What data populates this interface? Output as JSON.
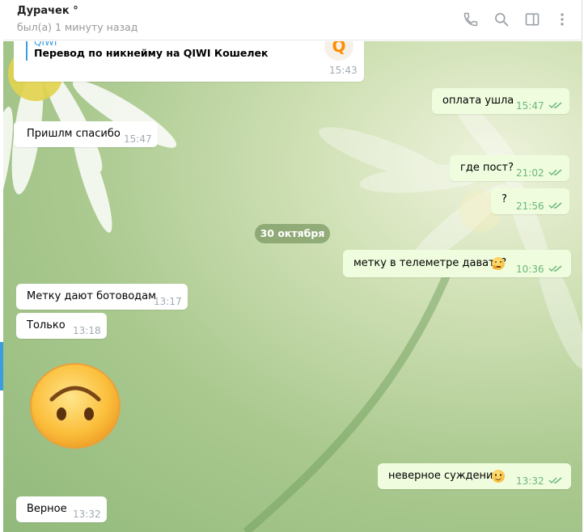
{
  "header": {
    "peer_name": "Дурачек °",
    "peer_status": "был(а) 1 минуту назад",
    "icons": [
      "phone-icon",
      "search-icon",
      "sidebar-toggle-icon",
      "more-vertical-icon"
    ]
  },
  "chat": {
    "qiwi_message": {
      "title_partial": "QIWI",
      "description": "Перевод по никнейму на QIWI Кошелек",
      "time": "15:43",
      "logo_letter": "Q"
    },
    "messages": [
      {
        "side": "out",
        "text": "оплата ушла",
        "time": "15:47",
        "read": true
      },
      {
        "side": "in",
        "text": "Пришлм спасибо",
        "time": "15:47"
      },
      {
        "side": "out",
        "text": "где пост?",
        "time": "21:02",
        "read": true
      },
      {
        "side": "out",
        "text": "?",
        "time": "21:56",
        "read": true
      },
      {
        "side": "out",
        "text": "метку в телеметре давать?",
        "emoji": "thinking-face",
        "time": "10:36",
        "read": true
      },
      {
        "side": "in",
        "text": "Метку дают ботоводам",
        "time": "13:17"
      },
      {
        "side": "in",
        "text": "Только",
        "time": "13:18"
      },
      {
        "side": "in",
        "sticker": "upside-down-face"
      },
      {
        "side": "out",
        "text": "неверное суждение",
        "emoji": "smiling-face",
        "time": "13:32",
        "read": true
      },
      {
        "side": "in",
        "text": "Верное",
        "time": "13:32"
      }
    ],
    "date_separator": "30 октября"
  },
  "colors": {
    "outgoing_bubble": "#effdde",
    "incoming_bubble": "#ffffff",
    "read_ticks": "#6cb67c",
    "qiwi_orange": "#ff8c00",
    "accent_blue": "#3b9ce0"
  }
}
